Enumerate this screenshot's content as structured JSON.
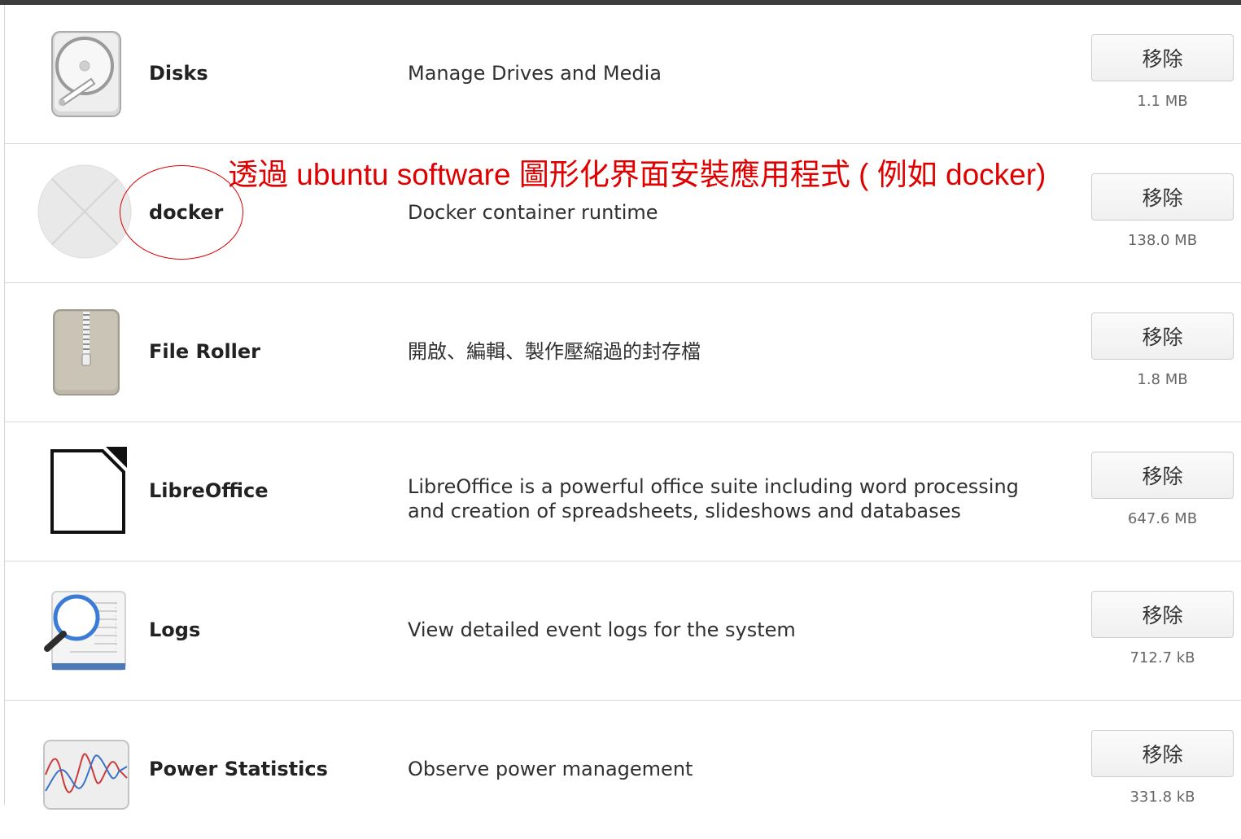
{
  "annotation": {
    "text": "透過 ubuntu software 圖形化界面安裝應用程式 ( 例如 docker)",
    "color": "#e00000"
  },
  "apps": [
    {
      "name": "Disks",
      "description": [
        "Manage Drives and Media"
      ],
      "remove_label": "移除",
      "size": "1.1 MB",
      "icon": "disks-icon"
    },
    {
      "name": "docker",
      "description": [
        "Docker container runtime"
      ],
      "remove_label": "移除",
      "size": "138.0 MB",
      "icon": "docker-icon"
    },
    {
      "name": "File Roller",
      "description": [
        "開啟、編輯、製作壓縮過的封存檔"
      ],
      "remove_label": "移除",
      "size": "1.8 MB",
      "icon": "file-roller-icon"
    },
    {
      "name": "LibreOffice",
      "description": [
        "LibreOffice is a powerful office suite including word processing",
        "and creation of spreadsheets, slideshows and databases"
      ],
      "remove_label": "移除",
      "size": "647.6 MB",
      "icon": "libreoffice-icon"
    },
    {
      "name": "Logs",
      "description": [
        "View detailed event logs for the system"
      ],
      "remove_label": "移除",
      "size": "712.7 kB",
      "icon": "logs-icon"
    },
    {
      "name": "Power Statistics",
      "description": [
        "Observe power management"
      ],
      "remove_label": "移除",
      "size": "331.8 kB",
      "icon": "power-statistics-icon"
    }
  ]
}
